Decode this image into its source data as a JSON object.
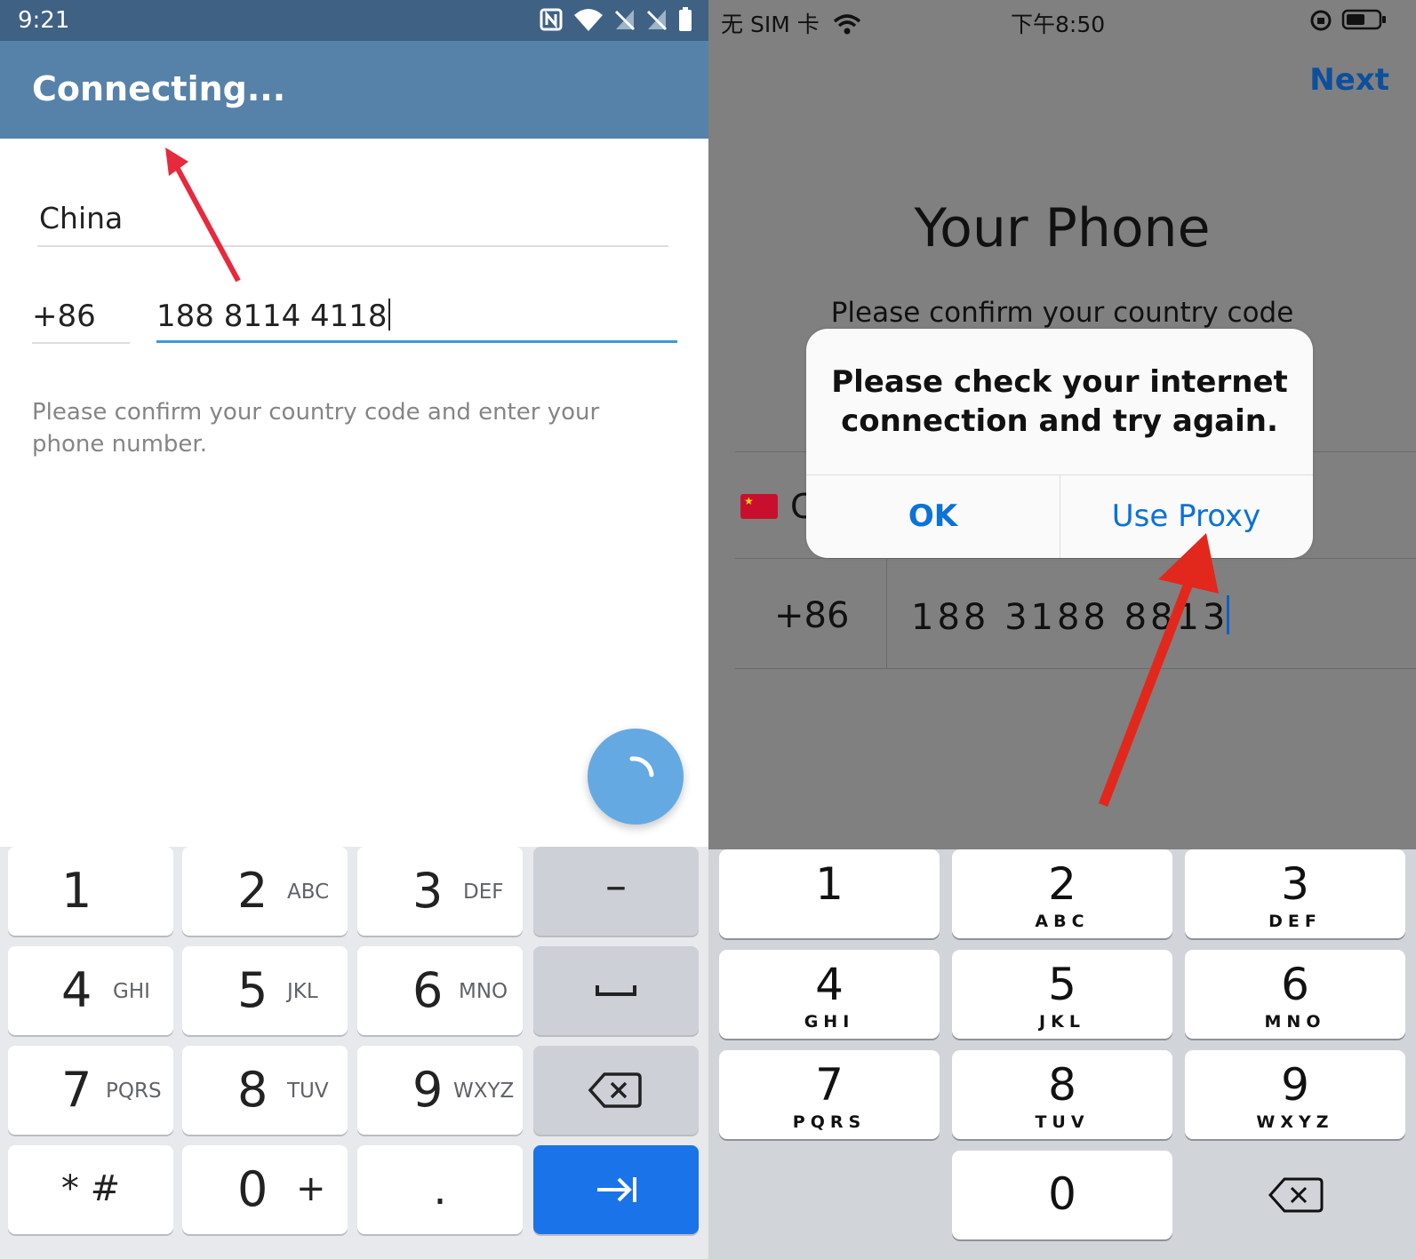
{
  "left": {
    "status_bar": {
      "time": "9:21",
      "icons": [
        "nfc-icon",
        "wifi-icon",
        "no-signal-icon",
        "no-signal-icon",
        "battery-icon"
      ]
    },
    "app_bar": {
      "title": "Connecting..."
    },
    "form": {
      "country": "China",
      "country_code": "+86",
      "phone_number": "188 8114 4118",
      "hint": "Please confirm your country code and enter your phone number."
    },
    "fab_icon": "spinner-icon",
    "keyboard": {
      "rows": [
        [
          {
            "num": "1",
            "letters": ""
          },
          {
            "num": "2",
            "letters": "ABC"
          },
          {
            "num": "3",
            "letters": "DEF"
          },
          {
            "sym": "–"
          }
        ],
        [
          {
            "num": "4",
            "letters": "GHI"
          },
          {
            "num": "5",
            "letters": "JKL"
          },
          {
            "num": "6",
            "letters": "MNO"
          },
          {
            "sym": "space-icon"
          }
        ],
        [
          {
            "num": "7",
            "letters": "PQRS"
          },
          {
            "num": "8",
            "letters": "TUV"
          },
          {
            "num": "9",
            "letters": "WXYZ"
          },
          {
            "sym": "backspace-icon"
          }
        ],
        [
          {
            "sym": "* #"
          },
          {
            "num": "0",
            "letters": "+"
          },
          {
            "sym": "."
          },
          {
            "sym": "next-icon"
          }
        ]
      ]
    },
    "annotation_arrow_color": "#e8283c"
  },
  "right": {
    "status_bar": {
      "carrier": "无 SIM 卡",
      "time": "下午8:50",
      "icons": [
        "wifi-icon",
        "orientation-lock-icon",
        "battery-icon"
      ]
    },
    "nav": {
      "next_label": "Next"
    },
    "heading": "Your Phone",
    "subtitle": "Please confirm your country code",
    "country_peek": "C",
    "country_code": "+86",
    "phone_number": "188 3188 8813",
    "alert": {
      "message": "Please check your internet connection and try again.",
      "ok_label": "OK",
      "proxy_label": "Use Proxy"
    },
    "keyboard": {
      "keys": [
        {
          "num": "1",
          "letters": ""
        },
        {
          "num": "2",
          "letters": "ABC"
        },
        {
          "num": "3",
          "letters": "DEF"
        },
        {
          "num": "4",
          "letters": "GHI"
        },
        {
          "num": "5",
          "letters": "JKL"
        },
        {
          "num": "6",
          "letters": "MNO"
        },
        {
          "num": "7",
          "letters": "PQRS"
        },
        {
          "num": "8",
          "letters": "TUV"
        },
        {
          "num": "9",
          "letters": "WXYZ"
        },
        {
          "num": "0",
          "letters": ""
        }
      ]
    },
    "annotation_arrow_color": "#e2281c"
  },
  "colors": {
    "android_status": "#3f6184",
    "android_appbar": "#5682a9",
    "android_accent": "#3d9ad6",
    "android_fab": "#65a9e2",
    "android_enter_key": "#1a73e8",
    "ios_link": "#0b72d8"
  }
}
